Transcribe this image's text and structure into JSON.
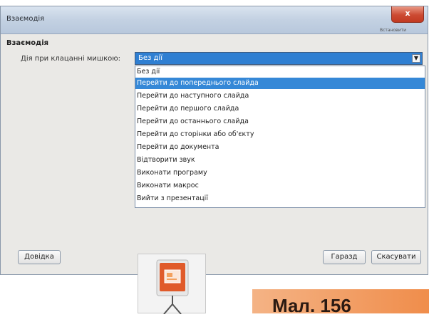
{
  "window": {
    "title": "Взаємодія",
    "hint": "Встановити",
    "close_label": "x"
  },
  "section_title": "Взаємодія",
  "field_label": "Дія при клацанні мишкою:",
  "select": {
    "value": "Без дії",
    "arrow": "▼"
  },
  "options": [
    {
      "label": "Без дії",
      "selected": false
    },
    {
      "label": "Перейти до попереднього слайда",
      "selected": true
    },
    {
      "label": "Перейти до наступного слайда",
      "selected": false
    },
    {
      "label": "Перейти до першого слайда",
      "selected": false
    },
    {
      "label": "Перейти до останнього слайда",
      "selected": false
    },
    {
      "label": "Перейти до сторінки або об'єкту",
      "selected": false
    },
    {
      "label": "Перейти до документа",
      "selected": false
    },
    {
      "label": "Відтворити звук",
      "selected": false
    },
    {
      "label": "Виконати програму",
      "selected": false
    },
    {
      "label": "Виконати макрос",
      "selected": false
    },
    {
      "label": "Вийти з презентації",
      "selected": false
    }
  ],
  "buttons": {
    "help": "Довідка",
    "ok": "Гаразд",
    "cancel": "Скасувати"
  },
  "icon": {
    "name": "presentation-icon"
  },
  "caption": "Мал. 156",
  "colors": {
    "selection": "#3588d7",
    "titlebar": "#c3d1e2",
    "close": "#cc4a32",
    "caption_bg": "#f08d4b"
  }
}
